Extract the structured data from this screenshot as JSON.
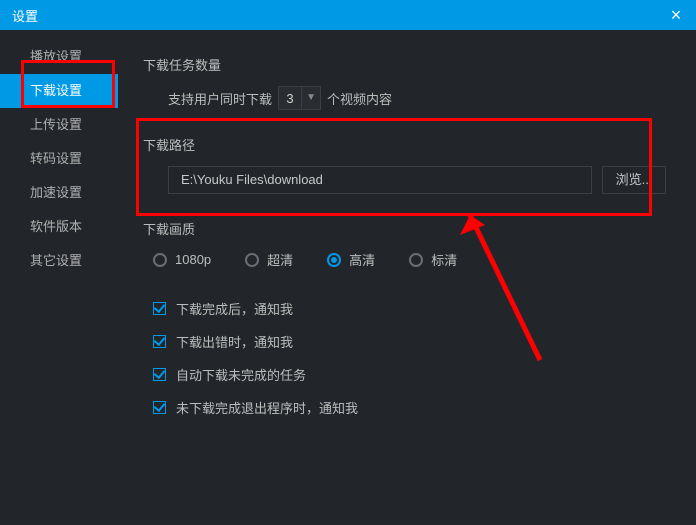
{
  "title": "设置",
  "sidebar": {
    "items": [
      {
        "label": "播放设置"
      },
      {
        "label": "下载设置"
      },
      {
        "label": "上传设置"
      },
      {
        "label": "转码设置"
      },
      {
        "label": "加速设置"
      },
      {
        "label": "软件版本"
      },
      {
        "label": "其它设置"
      }
    ],
    "activeIndex": 1
  },
  "downloadTasks": {
    "title": "下载任务数量",
    "prefix": "支持用户同时下载",
    "value": "3",
    "suffix": "个视频内容"
  },
  "downloadPath": {
    "title": "下载路径",
    "value": "E:\\Youku Files\\download",
    "browse": "浏览..."
  },
  "quality": {
    "title": "下载画质",
    "options": [
      "1080p",
      "超清",
      "高清",
      "标清"
    ],
    "selectedIndex": 2
  },
  "checkboxes": [
    {
      "label": "下载完成后，通知我",
      "checked": true
    },
    {
      "label": "下载出错时，通知我",
      "checked": true
    },
    {
      "label": "自动下载未完成的任务",
      "checked": true
    },
    {
      "label": "未下载完成退出程序时，通知我",
      "checked": true
    }
  ]
}
